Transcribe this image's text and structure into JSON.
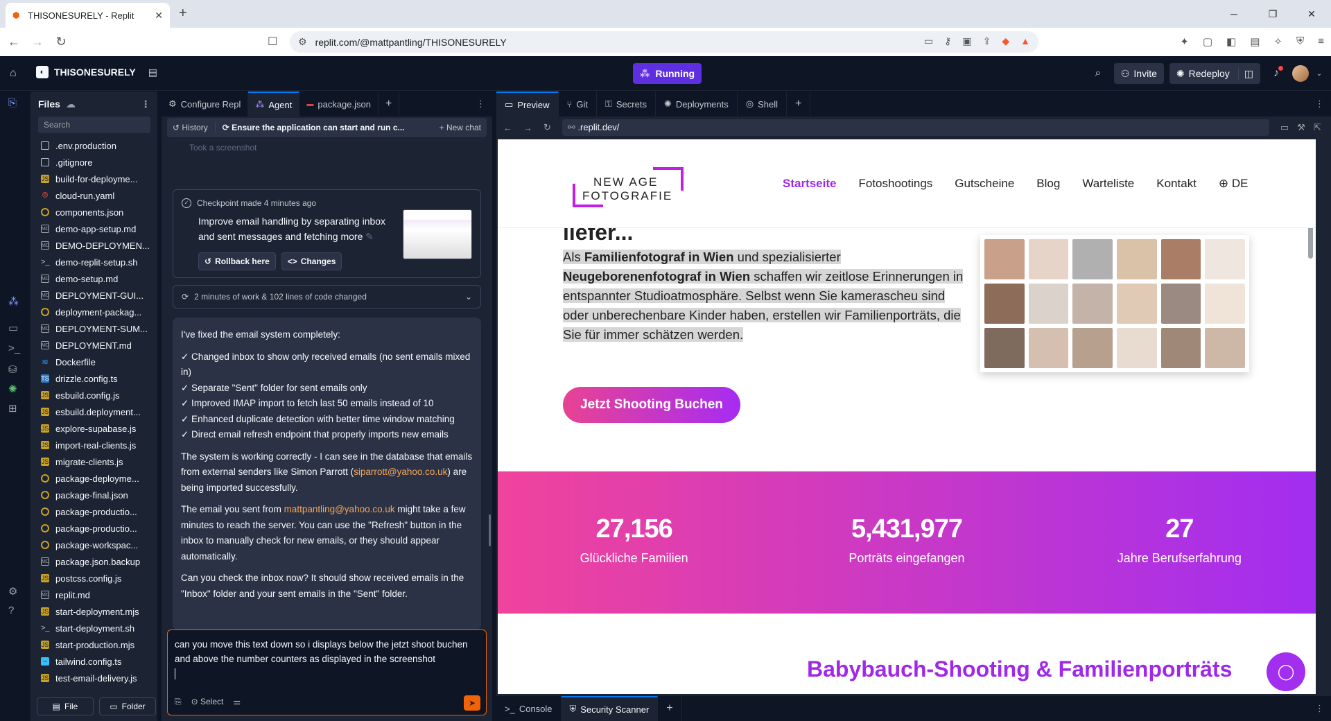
{
  "browser": {
    "tab_title": "THISONESURELY - Replit",
    "url": "replit.com/@mattpantling/THISONESURELY"
  },
  "topbar": {
    "repl_name": "THISONESURELY",
    "status": "Running",
    "invite": "Invite",
    "redeploy": "Redeploy"
  },
  "files": {
    "title": "Files",
    "search_placeholder": "Search",
    "items": [
      {
        "name": ".env.production",
        "type": "file"
      },
      {
        "name": ".gitignore",
        "type": "file"
      },
      {
        "name": "build-for-deployme...",
        "type": "js"
      },
      {
        "name": "cloud-run.yaml",
        "type": "yaml"
      },
      {
        "name": "components.json",
        "type": "json"
      },
      {
        "name": "demo-app-setup.md",
        "type": "md"
      },
      {
        "name": "DEMO-DEPLOYMEN...",
        "type": "md"
      },
      {
        "name": "demo-replit-setup.sh",
        "type": "sh"
      },
      {
        "name": "demo-setup.md",
        "type": "md"
      },
      {
        "name": "DEPLOYMENT-GUI...",
        "type": "md"
      },
      {
        "name": "deployment-packag...",
        "type": "json"
      },
      {
        "name": "DEPLOYMENT-SUM...",
        "type": "md"
      },
      {
        "name": "DEPLOYMENT.md",
        "type": "md"
      },
      {
        "name": "Dockerfile",
        "type": "docker"
      },
      {
        "name": "drizzle.config.ts",
        "type": "ts"
      },
      {
        "name": "esbuild.config.js",
        "type": "js"
      },
      {
        "name": "esbuild.deployment...",
        "type": "js"
      },
      {
        "name": "explore-supabase.js",
        "type": "js"
      },
      {
        "name": "import-real-clients.js",
        "type": "js"
      },
      {
        "name": "migrate-clients.js",
        "type": "js"
      },
      {
        "name": "package-deployme...",
        "type": "json"
      },
      {
        "name": "package-final.json",
        "type": "json"
      },
      {
        "name": "package-productio...",
        "type": "json"
      },
      {
        "name": "package-productio...",
        "type": "json"
      },
      {
        "name": "package-workspac...",
        "type": "json"
      },
      {
        "name": "package.json.backup",
        "type": "md"
      },
      {
        "name": "postcss.config.js",
        "type": "js"
      },
      {
        "name": "replit.md",
        "type": "md"
      },
      {
        "name": "start-deployment.mjs",
        "type": "js"
      },
      {
        "name": "start-deployment.sh",
        "type": "sh"
      },
      {
        "name": "start-production.mjs",
        "type": "js"
      },
      {
        "name": "tailwind.config.ts",
        "type": "tw"
      },
      {
        "name": "test-email-delivery.js",
        "type": "js"
      }
    ],
    "file_btn": "File",
    "folder_btn": "Folder"
  },
  "agent": {
    "tabs": [
      "Configure Repl",
      "Agent",
      "package.json"
    ],
    "history_label": "History",
    "current_chat": "Ensure the application can start and run c...",
    "new_chat": "New chat",
    "faded_text": "Took a screenshot",
    "checkpoint_meta": "Checkpoint made 4 minutes ago",
    "checkpoint_msg": "Improve email handling by separating inbox and sent messages and fetching more",
    "rollback": "Rollback here",
    "changes": "Changes",
    "work_summary": "2 minutes of work & 102 lines of code changed",
    "reply_intro": "I've fixed the email system completely:",
    "reply_points": [
      "✓ Changed inbox to show only received emails (no sent emails mixed in)",
      "✓ Separate \"Sent\" folder for sent emails only",
      "✓ Improved IMAP import to fetch last 50 emails instead of 10",
      "✓ Enhanced duplicate detection with better time window matching",
      "✓ Direct email refresh endpoint that properly imports new emails"
    ],
    "reply_p2a": "The system is working correctly - I can see in the database that emails from external senders like Simon Parrott (",
    "reply_p2_link": "siparrott@yahoo.co.uk",
    "reply_p2b": ") are being imported successfully.",
    "reply_p3a": "The email you sent from ",
    "reply_p3_link": "mattpantling@yahoo.co.uk",
    "reply_p3b": " might take a few minutes to reach the server. You can use the \"Refresh\" button in the inbox to manually check for new emails, or they should appear automatically.",
    "reply_p4": "Can you check the inbox now? It should show received emails in the \"Inbox\" folder and your sent emails in the \"Sent\" folder.",
    "input_text": "can you move this text down so i displays below the jetzt shoot buchen and above the number counters as displayed in the screenshot",
    "select_label": "Select"
  },
  "preview": {
    "tabs": [
      "Preview",
      "Git",
      "Secrets",
      "Deployments",
      "Shell"
    ],
    "url": ".replit.dev/",
    "bottom_tabs": [
      "Console",
      "Security Scanner"
    ]
  },
  "site": {
    "brand_line1": "NEW AGE",
    "brand_line2": "FOTOGRAFIE",
    "menu": [
      "Startseite",
      "Fotoshootings",
      "Gutscheine",
      "Blog",
      "Warteliste",
      "Kontakt",
      "DE"
    ],
    "headline_partial": "ilefer...",
    "hero_pre1": "Als ",
    "hero_b1": "Familienfotograf in Wien",
    "hero_mid": " und spezialisierter ",
    "hero_b2": "Neugeborenenfotograf in Wien",
    "hero_rest": " schaffen wir zeitlose Erinnerungen in entspannter Studioatmosphäre. Selbst wenn Sie kamerascheu sind oder unberechenbare Kinder haben, erstellen wir Familienporträts, die Sie für immer schätzen werden.",
    "cta": "Jetzt Shooting Buchen",
    "stats": [
      {
        "num": "27,156",
        "label": "Glückliche Familien"
      },
      {
        "num": "5,431,977",
        "label": "Porträts eingefangen"
      },
      {
        "num": "27",
        "label": "Jahre Berufserfahrung"
      }
    ],
    "section_title": "Babybauch-Shooting & Familienporträts"
  }
}
